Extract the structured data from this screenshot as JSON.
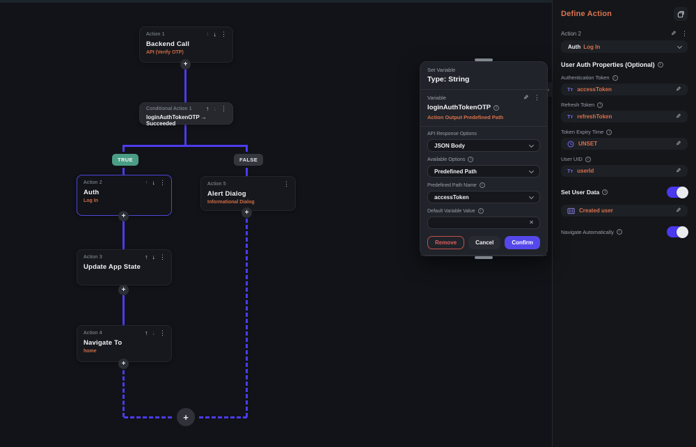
{
  "icons": {
    "up": "↑",
    "down": "↓",
    "kebab": "⋮",
    "plus": "+",
    "pencil": "✎",
    "info": "i",
    "close": "✕",
    "collapse": "◂",
    "text_type": "Tт"
  },
  "colors": {
    "accent_purple": "#4b39ef",
    "accent_orange": "#d9714b",
    "true_badge": "#4a9e85",
    "false_badge": "#33363d",
    "confirm_button": "#5548eb",
    "remove_button": "#dd5f5f"
  },
  "canvas": {
    "nodes": {
      "action1": {
        "label": "Action 1",
        "title": "Backend Call",
        "subtitle": "API (Verify OTP)"
      },
      "conditional1": {
        "label": "Conditional Action 1",
        "expression": "loginAuthTokenOTP → Succeeded"
      },
      "action2": {
        "label": "Action 2",
        "title": "Auth",
        "subtitle": "Log In"
      },
      "action5": {
        "label": "Action 5",
        "title": "Alert Dialog",
        "subtitle": "Informational Dialog"
      },
      "action3": {
        "label": "Action 3",
        "title": "Update App State"
      },
      "action4": {
        "label": "Action 4",
        "title": "Navigate To",
        "subtitle": "home"
      }
    },
    "branches": {
      "true_label": "TRUE",
      "false_label": "FALSE"
    }
  },
  "modal": {
    "eyebrow": "Set Variable",
    "title": "Type: String",
    "variable_section": {
      "label": "Variable",
      "name": "loginAuthTokenOTP",
      "description": "Action Output Predefined Path"
    },
    "fields": [
      {
        "label": "API Response Options",
        "value": "JSON Body"
      },
      {
        "label": "Available Options",
        "value": "Predefined Path"
      },
      {
        "label": "Predefined Path Name",
        "value": "accessToken"
      }
    ],
    "default_value_field": {
      "label": "Default Variable Value",
      "value": ""
    },
    "buttons": {
      "remove": "Remove",
      "cancel": "Cancel",
      "confirm": "Confirm"
    }
  },
  "panel": {
    "title": "Define Action",
    "action_label": "Action 2",
    "action_selector": {
      "primary": "Auth",
      "secondary": "Log In"
    },
    "section_title": "User Auth Properties (Optional)",
    "fields": [
      {
        "label": "Authentication Token",
        "value": "accessToken"
      },
      {
        "label": "Refresh Token",
        "value": "refreshToken"
      },
      {
        "label": "Token Expiry Time",
        "value": "UNSET"
      },
      {
        "label": "User UID",
        "value": "userId"
      }
    ],
    "set_user_data": {
      "label": "Set User Data",
      "value": "Created user"
    },
    "navigate_automatically": {
      "label": "Navigate Automatically"
    }
  }
}
